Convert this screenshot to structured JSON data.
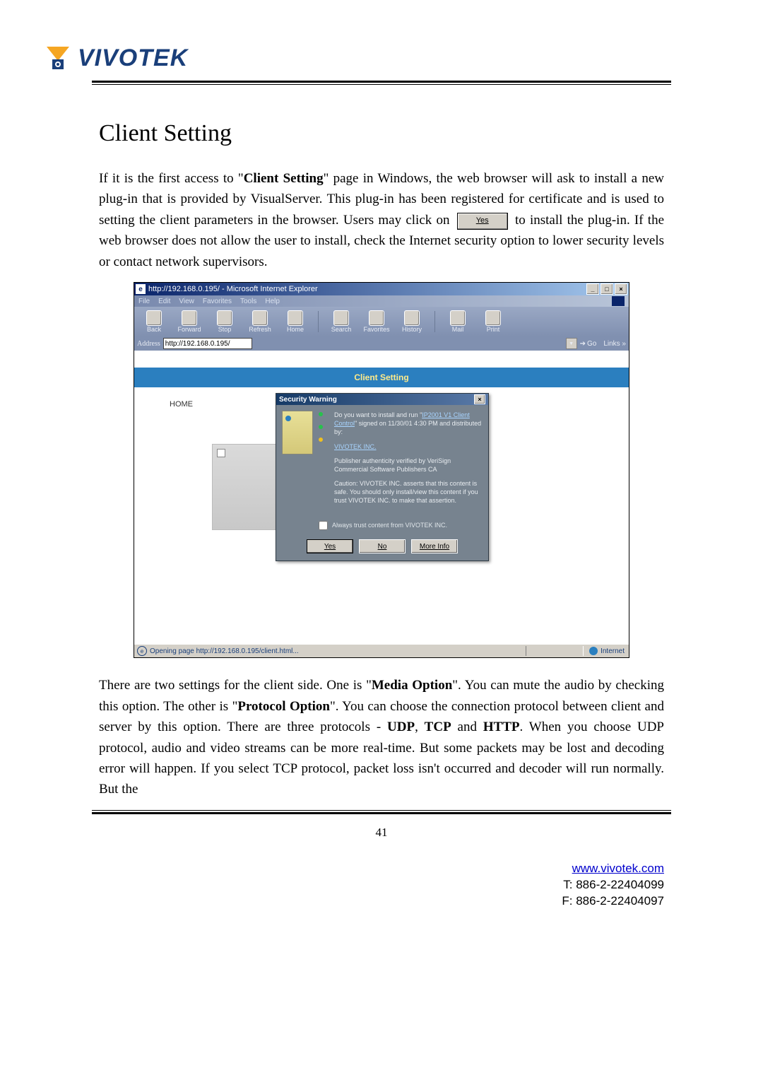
{
  "logo_text": "VIVOTEK",
  "title": "Client Setting",
  "para1_before_bold": "If it is the first access to \"",
  "para1_bold1": "Client Setting",
  "para1_mid": "\" page in Windows, the web browser will ask to install a new plug-in that is provided by VisualServer. This plug-in has been registered for certificate and is used to setting the client parameters in the browser. Users may click on ",
  "inline_yes": "Yes",
  "para1_after": " to install the plug-in. If the web browser does not allow the user to install, check the Internet security option to lower security levels or contact network supervisors.",
  "para2_a": "There are two settings for the client side. One is \"",
  "para2_b1": "Media Option",
  "para2_b": "\". You can mute the audio by checking this option. The other is \"",
  "para2_b2": "Protocol Option",
  "para2_c": "\". You can choose the connection protocol between client and server by this option. There are three protocols - ",
  "para2_udp": "UDP",
  "para2_comma": ", ",
  "para2_tcp": "TCP",
  "para2_and": " and ",
  "para2_http": "HTTP",
  "para2_d": ". When you choose UDP protocol, audio and video streams can be more real-time. But some packets may be lost and decoding error will happen. If you select TCP protocol, packet loss isn't occurred and decoder will run normally. But the",
  "page_number": "41",
  "footer_url": "www.vivotek.com",
  "footer_tel": "T: 886-2-22404099",
  "footer_fax": "F: 886-2-22404097",
  "ie": {
    "title": "http://192.168.0.195/ - Microsoft Internet Explorer",
    "menu": [
      "File",
      "Edit",
      "View",
      "Favorites",
      "Tools",
      "Help"
    ],
    "toolbar": [
      {
        "label": "Back"
      },
      {
        "label": "Forward"
      },
      {
        "label": "Stop"
      },
      {
        "label": "Refresh"
      },
      {
        "label": "Home"
      },
      {
        "label": "Search"
      },
      {
        "label": "Favorites"
      },
      {
        "label": "History"
      },
      {
        "label": "Mail"
      },
      {
        "label": "Print"
      }
    ],
    "address_label": "Address",
    "address_value": "http://192.168.0.195/",
    "go_label": "Go",
    "links_label": "Links »",
    "banner": "Client Setting",
    "home": "HOME",
    "status_left": "Opening page http://192.168.0.195/client.html...",
    "status_zone": "Internet"
  },
  "dialog": {
    "title": "Security Warning",
    "line1a": "Do you want to install and run \"",
    "line1link": "IP2001 V1 Client Control",
    "line1b": "\" signed on 11/30/01 4:30 PM and distributed by:",
    "publisher": "VIVOTEK INC.",
    "line2": "Publisher authenticity verified by VeriSign Commercial Software Publishers CA",
    "line3": "Caution: VIVOTEK INC. asserts that this content is safe. You should only install/view this content if you trust VIVOTEK INC. to make that assertion.",
    "checkbox": "Always trust content from VIVOTEK INC.",
    "yes": "Yes",
    "no": "No",
    "more": "More Info"
  }
}
